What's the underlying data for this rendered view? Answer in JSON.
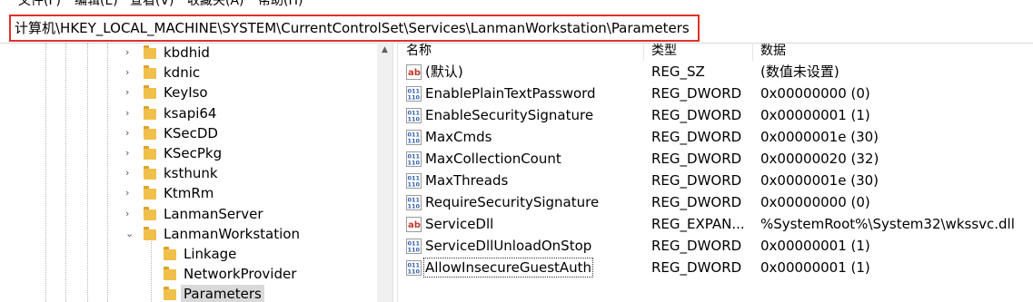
{
  "menu": [
    "文件(F)",
    "编辑(E)",
    "查看(V)",
    "收藏夹(A)",
    "帮助(H)"
  ],
  "address": "计算机\\HKEY_LOCAL_MACHINE\\SYSTEM\\CurrentControlSet\\Services\\LanmanWorkstation\\Parameters",
  "tree": {
    "items": [
      {
        "label": "kbdhid",
        "level": 1,
        "expander": "›"
      },
      {
        "label": "kdnic",
        "level": 1,
        "expander": "›"
      },
      {
        "label": "KeyIso",
        "level": 1,
        "expander": "›"
      },
      {
        "label": "ksapi64",
        "level": 1,
        "expander": "›"
      },
      {
        "label": "KSecDD",
        "level": 1,
        "expander": "›"
      },
      {
        "label": "KSecPkg",
        "level": 1,
        "expander": "›"
      },
      {
        "label": "ksthunk",
        "level": 1,
        "expander": "›"
      },
      {
        "label": "KtmRm",
        "level": 1,
        "expander": "›"
      },
      {
        "label": "LanmanServer",
        "level": 1,
        "expander": "›"
      },
      {
        "label": "LanmanWorkstation",
        "level": 1,
        "expander": "⌄"
      },
      {
        "label": "Linkage",
        "level": 2,
        "expander": ""
      },
      {
        "label": "NetworkProvider",
        "level": 2,
        "expander": ""
      },
      {
        "label": "Parameters",
        "level": 2,
        "expander": "",
        "selected": true
      }
    ]
  },
  "columns": {
    "name": "名称",
    "type": "类型",
    "data": "数据"
  },
  "values": [
    {
      "icon": "string-value-icon",
      "name": "(默认)",
      "type": "REG_SZ",
      "data": "(数值未设置)"
    },
    {
      "icon": "binary-value-icon",
      "name": "EnablePlainTextPassword",
      "type": "REG_DWORD",
      "data": "0x00000000 (0)"
    },
    {
      "icon": "binary-value-icon",
      "name": "EnableSecuritySignature",
      "type": "REG_DWORD",
      "data": "0x00000001 (1)"
    },
    {
      "icon": "binary-value-icon",
      "name": "MaxCmds",
      "type": "REG_DWORD",
      "data": "0x0000001e (30)"
    },
    {
      "icon": "binary-value-icon",
      "name": "MaxCollectionCount",
      "type": "REG_DWORD",
      "data": "0x00000020 (32)"
    },
    {
      "icon": "binary-value-icon",
      "name": "MaxThreads",
      "type": "REG_DWORD",
      "data": "0x0000001e (30)"
    },
    {
      "icon": "binary-value-icon",
      "name": "RequireSecuritySignature",
      "type": "REG_DWORD",
      "data": "0x00000000 (0)"
    },
    {
      "icon": "string-value-icon",
      "name": "ServiceDll",
      "type": "REG_EXPAN...",
      "data": "%SystemRoot%\\System32\\wkssvc.dll"
    },
    {
      "icon": "binary-value-icon",
      "name": "ServiceDllUnloadOnStop",
      "type": "REG_DWORD",
      "data": "0x00000001 (1)"
    },
    {
      "icon": "binary-value-icon",
      "name": "AllowInsecureGuestAuth",
      "type": "REG_DWORD",
      "data": "0x00000001 (1)",
      "focused": true
    }
  ],
  "colors": {
    "highlight": "#e0312a",
    "folder": "#f0c04a",
    "selection": "#d9d9d9"
  }
}
